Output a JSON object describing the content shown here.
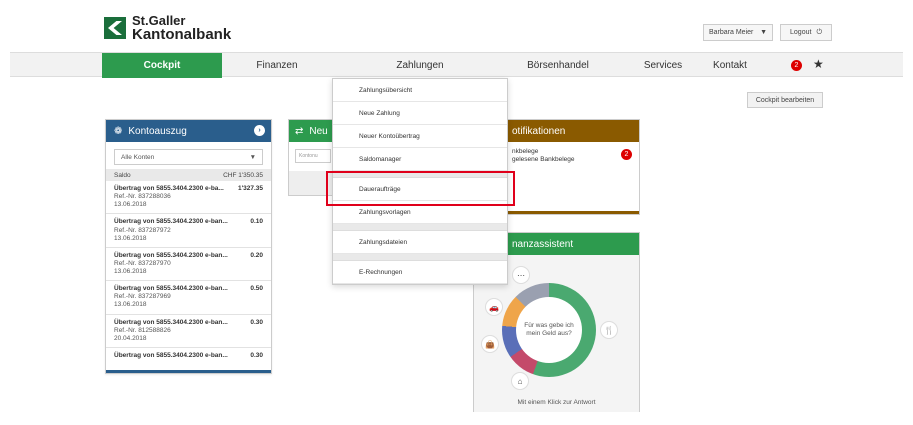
{
  "header": {
    "brand_line1": "St.Galler",
    "brand_line2": "Kantonalbank",
    "user_name": "Barbara Meier",
    "logout_label": "Logout",
    "icons": [
      "chevron-down-icon",
      "power-icon"
    ]
  },
  "nav": {
    "items": [
      {
        "label": "Cockpit",
        "active": true
      },
      {
        "label": "Finanzen"
      },
      {
        "label": "Zahlungen"
      },
      {
        "label": "Börsenhandel"
      },
      {
        "label": "Services"
      },
      {
        "label": "Kontakt"
      }
    ],
    "badge_count": "2",
    "star_icon": "star-icon"
  },
  "cockpit_edit_label": "Cockpit bearbeiten",
  "kontoauszug": {
    "title": "Kontoauszug",
    "filter": "Alle Konten",
    "saldo_label": "Saldo",
    "saldo_value": "CHF 1'350.35",
    "rows": [
      {
        "title": "Übertrag von 5855.3404.2300 e-ba...",
        "amount": "1'327.35",
        "ref": "Ref.-Nr. 837288036",
        "date": "13.06.2018"
      },
      {
        "title": "Übertrag von 5855.3404.2300 e-ban...",
        "amount": "0.10",
        "ref": "Ref.-Nr. 837287972",
        "date": "13.06.2018"
      },
      {
        "title": "Übertrag von 5855.3404.2300 e-ban...",
        "amount": "0.20",
        "ref": "Ref.-Nr. 837287970",
        "date": "13.06.2018"
      },
      {
        "title": "Übertrag von 5855.3404.2300 e-ban...",
        "amount": "0.50",
        "ref": "Ref.-Nr. 837287969",
        "date": "13.06.2018"
      },
      {
        "title": "Übertrag von 5855.3404.2300 e-ban...",
        "amount": "0.30",
        "ref": "Ref.-Nr. 812588826",
        "date": "20.04.2018"
      },
      {
        "title": "Übertrag von 5855.3404.2300 e-ban...",
        "amount": "0.30",
        "ref": "",
        "date": ""
      }
    ]
  },
  "neue_zahlung": {
    "title": "Neu",
    "field": "Kontonu"
  },
  "notifikationen": {
    "title": "otifikationen",
    "line1": "nkbelege",
    "line2": "gelesene Bankbelege",
    "badge": "2"
  },
  "finanzassistent": {
    "title": "nanzassistent",
    "center_text": "Für was gebe ich mein Geld aus?",
    "footer": "Mit einem Klick zur Antwort",
    "icons": [
      "more-icon",
      "car-icon",
      "shopping-icon",
      "food-icon",
      "home-icon"
    ]
  },
  "dropdown": {
    "items": [
      "Zahlungsübersicht",
      "Neue Zahlung",
      "Neuer Kontoübertrag",
      "Saldomanager",
      "Daueraufträge",
      "Zahlungsvorlagen",
      "Zahlungsdateien",
      "E-Rechnungen"
    ]
  },
  "colors": {
    "brand_green": "#2d9b4e",
    "blue": "#2a5e8c",
    "brown": "#8a5a00",
    "highlight_red": "#e0001b"
  }
}
